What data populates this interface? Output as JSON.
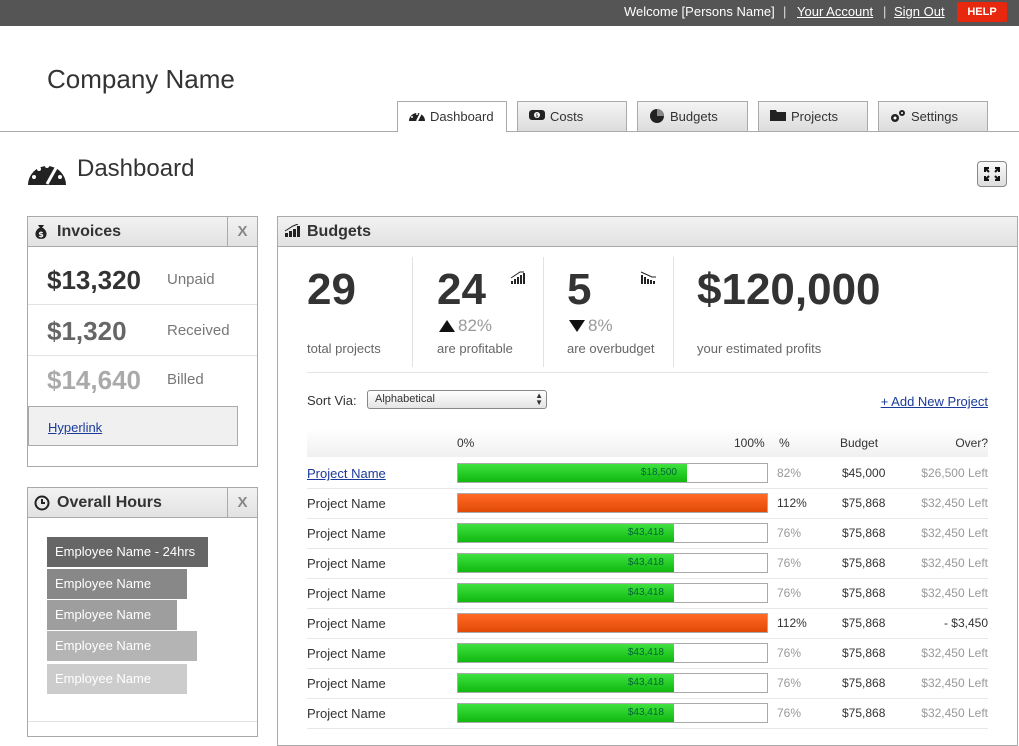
{
  "topbar": {
    "welcome": "Welcome [Persons Name]",
    "separator": "|",
    "account_link": "Your Account",
    "signout_link": "Sign Out",
    "help_label": "HELP"
  },
  "company_name": "Company Name",
  "tabs": [
    {
      "label": "Dashboard",
      "icon": "gauge-icon",
      "active": true
    },
    {
      "label": "Costs",
      "icon": "money-icon",
      "active": false
    },
    {
      "label": "Budgets",
      "icon": "pie-icon",
      "active": false
    },
    {
      "label": "Projects",
      "icon": "folder-icon",
      "active": false
    },
    {
      "label": "Settings",
      "icon": "gears-icon",
      "active": false
    }
  ],
  "page_title": "Dashboard",
  "invoices": {
    "title": "Invoices",
    "close_label": "X",
    "rows": [
      {
        "amount": "$13,320",
        "label": "Unpaid",
        "color": "#333333"
      },
      {
        "amount": "$1,320",
        "label": "Received",
        "color": "#666666"
      },
      {
        "amount": "$14,640",
        "label": "Billed",
        "color": "#aaaaaa"
      }
    ],
    "link": "Hyperlink"
  },
  "hours": {
    "title": "Overall Hours",
    "close_label": "X",
    "employees": [
      {
        "name": "Employee Name - 24hrs",
        "fraction": 1.0,
        "color": "#666666"
      },
      {
        "name": "Employee Name",
        "fraction": 0.87,
        "color": "#888888"
      },
      {
        "name": "Employee Name",
        "fraction": 0.81,
        "color": "#9e9e9e"
      },
      {
        "name": "Employee Name",
        "fraction": 0.93,
        "color": "#b4b4b4"
      },
      {
        "name": "Employee Name",
        "fraction": 0.87,
        "color": "#cccccc"
      }
    ]
  },
  "budgets": {
    "title": "Budgets",
    "stats": {
      "total": {
        "value": "29",
        "label": "total projects"
      },
      "profitable": {
        "value": "24",
        "delta": "82%",
        "label": "are profitable"
      },
      "overbudget": {
        "value": "5",
        "delta": "8%",
        "label": "are overbudget"
      },
      "profits": {
        "value": "$120,000",
        "label": "your estimated profits"
      }
    },
    "sort_label": "Sort Via:",
    "sort_value": "Alphabetical",
    "add_link": "+ Add New Project",
    "headers": {
      "start": "0%",
      "end": "100%",
      "pct": "%",
      "budget": "Budget",
      "over": "Over?"
    },
    "projects": [
      {
        "name": "Project Name",
        "link": true,
        "fill": 0.74,
        "fill_label": "$18,500",
        "status": "green",
        "pct": "82%",
        "budget": "$45,000",
        "over": "$26,500 Left"
      },
      {
        "name": "Project Name",
        "link": false,
        "fill": 1.0,
        "fill_label": "",
        "status": "orange",
        "pct": "112%",
        "budget": "$75,868",
        "over": "$32,450 Left"
      },
      {
        "name": "Project Name",
        "link": false,
        "fill": 0.7,
        "fill_label": "$43,418",
        "status": "green",
        "pct": "76%",
        "budget": "$75,868",
        "over": "$32,450 Left"
      },
      {
        "name": "Project Name",
        "link": false,
        "fill": 0.7,
        "fill_label": "$43,418",
        "status": "green",
        "pct": "76%",
        "budget": "$75,868",
        "over": "$32,450 Left"
      },
      {
        "name": "Project Name",
        "link": false,
        "fill": 0.7,
        "fill_label": "$43,418",
        "status": "green",
        "pct": "76%",
        "budget": "$75,868",
        "over": "$32,450 Left"
      },
      {
        "name": "Project Name",
        "link": false,
        "fill": 1.0,
        "fill_label": "",
        "status": "orange",
        "pct": "112%",
        "budget": "$75,868",
        "over": "- $3,450"
      },
      {
        "name": "Project Name",
        "link": false,
        "fill": 0.7,
        "fill_label": "$43,418",
        "status": "green",
        "pct": "76%",
        "budget": "$75,868",
        "over": "$32,450 Left"
      },
      {
        "name": "Project Name",
        "link": false,
        "fill": 0.7,
        "fill_label": "$43,418",
        "status": "green",
        "pct": "76%",
        "budget": "$75,868",
        "over": "$32,450 Left"
      },
      {
        "name": "Project Name",
        "link": false,
        "fill": 0.7,
        "fill_label": "$43,418",
        "status": "green",
        "pct": "76%",
        "budget": "$75,868",
        "over": "$32,450 Left"
      }
    ]
  }
}
